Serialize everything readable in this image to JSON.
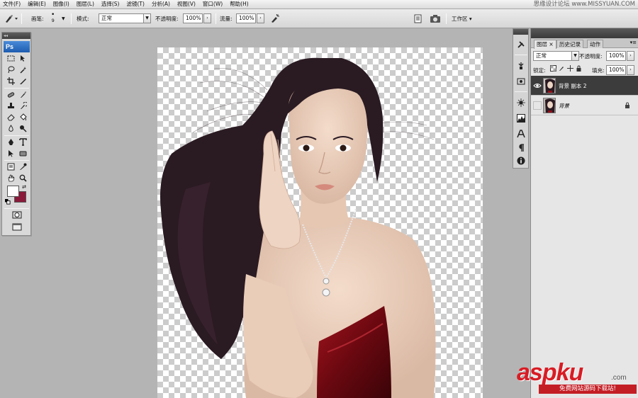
{
  "menu": {
    "items": [
      "文件(F)",
      "编辑(E)",
      "图像(I)",
      "图层(L)",
      "选择(S)",
      "滤镜(T)",
      "分析(A)",
      "视图(V)",
      "窗口(W)",
      "帮助(H)"
    ]
  },
  "watermark_top": "思缘设计论坛 www.MISSYUAN.COM",
  "options": {
    "brush_label": "画笔:",
    "brush_size": "9",
    "mode_label": "模式:",
    "mode_value": "正常",
    "opacity_label": "不透明度:",
    "opacity_value": "100%",
    "flow_label": "流量:",
    "flow_value": "100%",
    "workspace_label": "工作区 ▾"
  },
  "toolbox": {
    "logo": "Ps",
    "foreground_color": "#ffffff",
    "background_color": "#8b1a3a"
  },
  "layers_panel": {
    "tabs": [
      "图层",
      "历史记录",
      "动作"
    ],
    "blend_mode": "正常",
    "opacity_label": "不透明度:",
    "opacity_value": "100%",
    "lock_label": "锁定:",
    "fill_label": "填充:",
    "fill_value": "100%",
    "layers": [
      {
        "name": "背景 副本 2",
        "visible": true,
        "selected": true,
        "locked": false
      },
      {
        "name": "背景",
        "visible": false,
        "selected": false,
        "locked": true
      }
    ]
  },
  "watermark": {
    "brand": "aspku",
    "domain": ".com",
    "subtitle": "免费网站源码下载站!"
  }
}
